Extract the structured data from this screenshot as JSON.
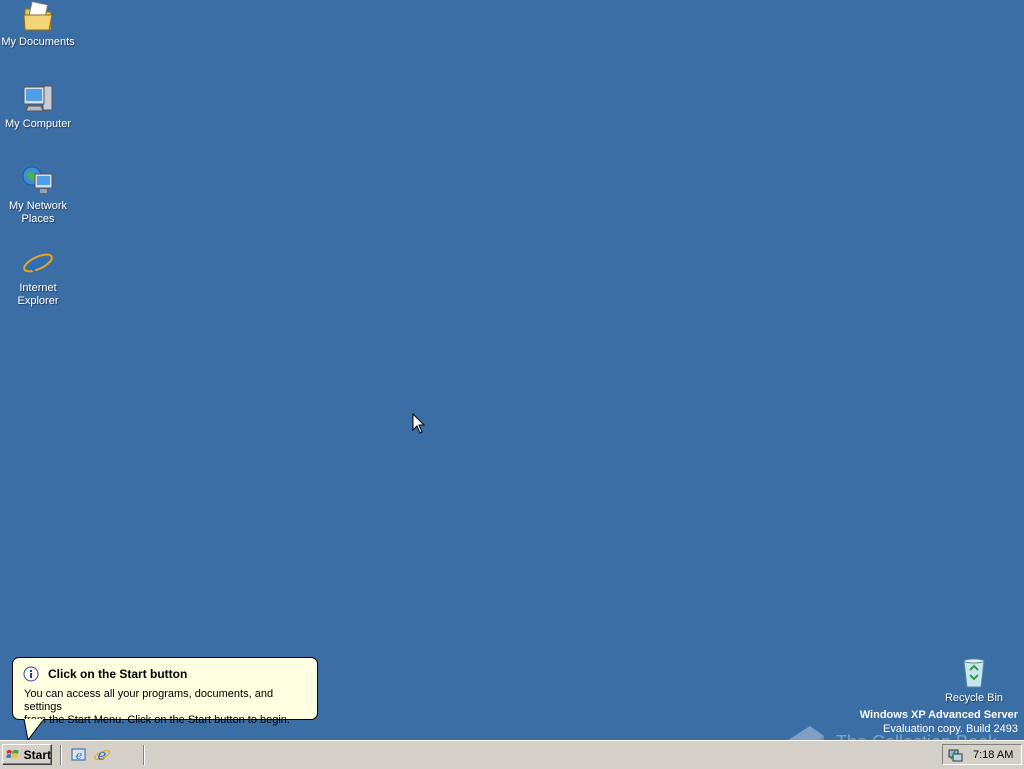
{
  "desktop": {
    "background_color": "#3a6ea5",
    "icons": [
      {
        "label": "My Documents",
        "icon": "my-documents-icon"
      },
      {
        "label": "My Computer",
        "icon": "my-computer-icon"
      },
      {
        "label": "My Network\nPlaces",
        "icon": "my-network-places-icon"
      },
      {
        "label": "Internet\nExplorer",
        "icon": "internet-explorer-icon"
      },
      {
        "label": "Recycle Bin",
        "icon": "recycle-bin-icon"
      }
    ]
  },
  "watermark": {
    "title": "Windows XP Advanced Server",
    "subtitle": "Evaluation copy. Build 2493"
  },
  "overlay_mark": {
    "text": "The Collection Book"
  },
  "balloon": {
    "title": "Click on the Start button",
    "text": "You can access all your programs, documents, and settings\nfrom the Start Menu. Click on the Start button to begin.",
    "icon": "info-icon"
  },
  "taskbar": {
    "start_label": "Start",
    "quick_launch": [
      {
        "icon": "show-desktop-icon"
      },
      {
        "icon": "internet-explorer-icon"
      }
    ],
    "tray": {
      "icons": [
        "network-connection-icon"
      ],
      "clock": "7:18 AM"
    }
  }
}
